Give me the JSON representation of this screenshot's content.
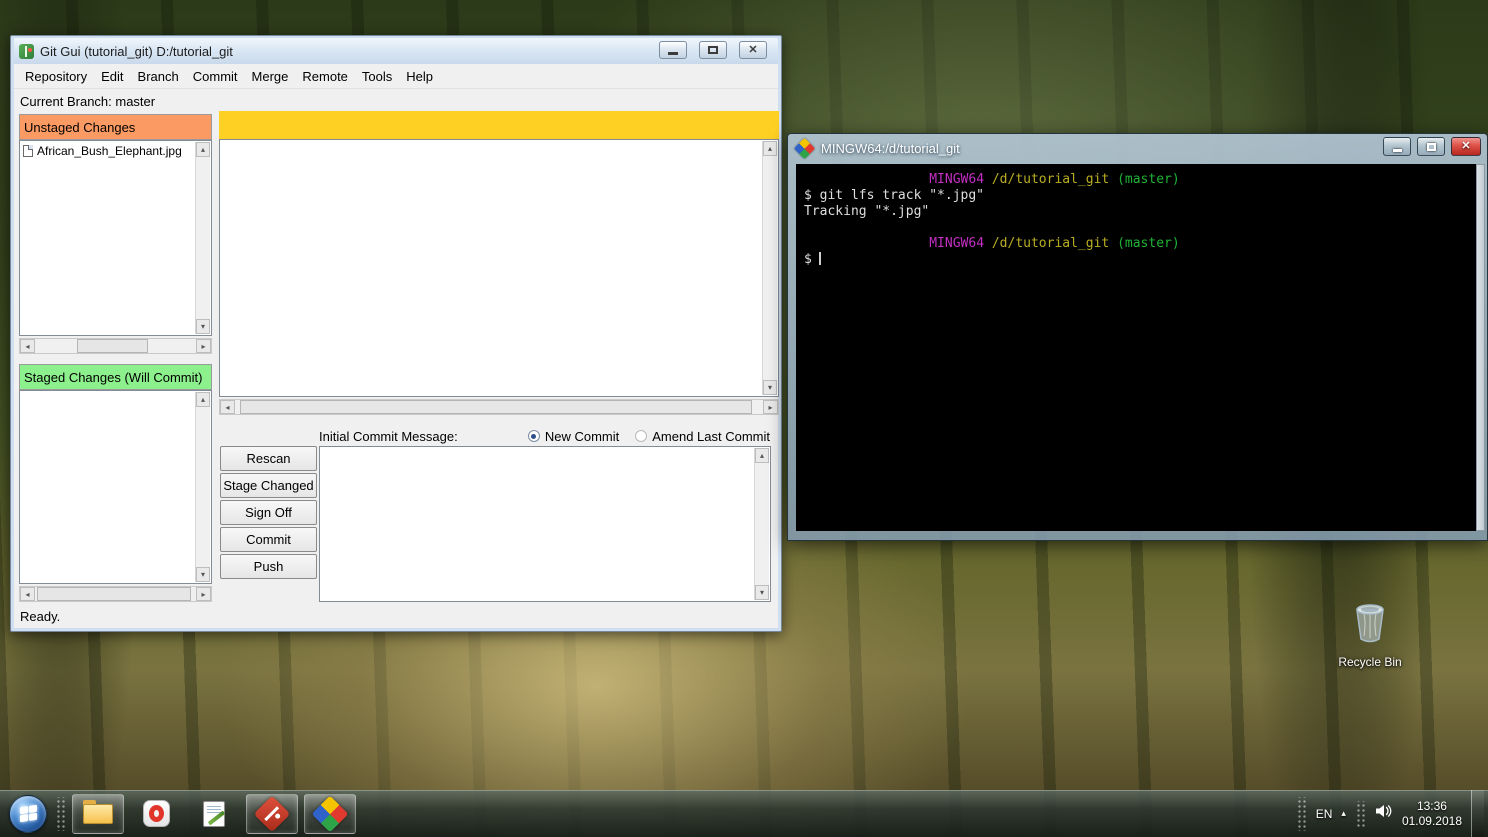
{
  "desktop": {
    "recycle_bin_label": "Recycle Bin"
  },
  "git_gui": {
    "title": "Git Gui (tutorial_git) D:/tutorial_git",
    "menu": [
      "Repository",
      "Edit",
      "Branch",
      "Commit",
      "Merge",
      "Remote",
      "Tools",
      "Help"
    ],
    "current_branch_label": "Current Branch: master",
    "unstaged_header": "Unstaged Changes",
    "unstaged_files": [
      "African_Bush_Elephant.jpg"
    ],
    "staged_header": "Staged Changes (Will Commit)",
    "commit_label": "Initial Commit Message:",
    "radio_new_commit": "New Commit",
    "radio_amend": "Amend Last Commit",
    "buttons": [
      "Rescan",
      "Stage Changed",
      "Sign Off",
      "Commit",
      "Push"
    ],
    "status": "Ready."
  },
  "terminal": {
    "title": "MINGW64:/d/tutorial_git",
    "prompt_indent": "                ",
    "prompt_host": "MINGW64",
    "prompt_path": "/d/tutorial_git",
    "prompt_branch": "(master)",
    "command_1": "$ git lfs track \"*.jpg\"",
    "output_1": "Tracking \"*.jpg\"",
    "prompt_symbol": "$",
    "colors": {
      "host": "#c32ec3",
      "path": "#b9ae22",
      "branch": "#1db336",
      "text": "#dfdfdf",
      "background": "#000000"
    }
  },
  "taskbar": {
    "language": "EN",
    "time": "13:36",
    "date": "01.09.2018"
  },
  "icons": {
    "scroll_up": "▴",
    "scroll_down": "▾",
    "scroll_left": "◂",
    "scroll_right": "▸",
    "close": "✕",
    "hidden_icons_arrow": "▴"
  }
}
